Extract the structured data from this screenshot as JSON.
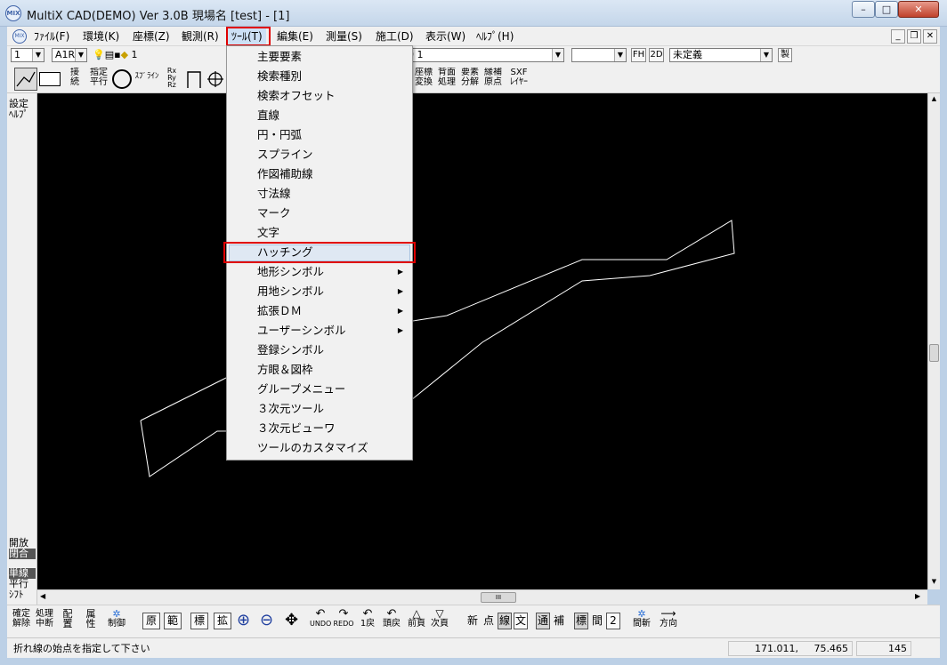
{
  "window": {
    "app_icon_text": "MIX",
    "title": "MultiX CAD(DEMO)   Ver 3.0B   現場名 [test]   - [1]",
    "minimize_glyph": "–",
    "maximize_glyph": "□",
    "close_glyph": "✕"
  },
  "menubar": {
    "items": [
      "ﾌｧｲﾙ(F)",
      "環境(K)",
      "座標(Z)",
      "観測(R)",
      "ﾂｰﾙ(T)",
      "編集(E)",
      "測量(S)",
      "施工(D)",
      "表示(W)",
      "ﾍﾙﾌﾟ(H)"
    ],
    "active_item": "ﾂｰﾙ(T)",
    "mdi_buttons": [
      "_",
      "❒",
      "✕"
    ]
  },
  "toolbar_row1": {
    "combo_scale": "1",
    "combo_layer": "A1R",
    "layer_value": "1",
    "combo_line_style": "0 1",
    "combo_blank": "",
    "fh_label": "FH",
    "mode_2d_label": "2D",
    "combo_undefined": "未定義",
    "make_label": "製"
  },
  "toolbar_row2": {
    "tools_left": [
      "接\n続",
      "指定\n平行",
      "ｽﾌﾟﾗｲﾝ",
      "Rx\nRy\nRz"
    ],
    "tools_right": [
      "座標\n変換",
      "背面\n処理",
      "要素\n分解",
      "縁補\n原点",
      "SXF\nﾚｲﾔｰ"
    ]
  },
  "left_panel": {
    "top": [
      "設定",
      "ﾍﾙﾌﾟ"
    ],
    "bottom": [
      "開放",
      "閉合",
      "単線",
      "平行",
      "ｼﾌﾄ"
    ]
  },
  "tools_menu": {
    "items": [
      {
        "label": "主要要素",
        "submenu": false
      },
      {
        "label": "検索種別",
        "submenu": false
      },
      {
        "label": "検索オフセット",
        "submenu": false
      },
      {
        "label": "直線",
        "submenu": false
      },
      {
        "label": "円・円弧",
        "submenu": false
      },
      {
        "label": "スプライン",
        "submenu": false
      },
      {
        "label": "作図補助線",
        "submenu": false
      },
      {
        "label": "寸法線",
        "submenu": false
      },
      {
        "label": "マーク",
        "submenu": false
      },
      {
        "label": "文字",
        "submenu": false
      },
      {
        "label": "ハッチング",
        "submenu": false
      },
      {
        "label": "地形シンボル",
        "submenu": true
      },
      {
        "label": "用地シンボル",
        "submenu": true
      },
      {
        "label": "拡張ＤＭ",
        "submenu": true
      },
      {
        "label": "ユーザーシンボル",
        "submenu": true
      },
      {
        "label": "登録シンボル",
        "submenu": false
      },
      {
        "label": "方眼＆図枠",
        "submenu": false
      },
      {
        "label": "グループメニュー",
        "submenu": false
      },
      {
        "label": "３次元ツール",
        "submenu": false
      },
      {
        "label": "３次元ビューワ",
        "submenu": false
      },
      {
        "label": "ツールのカスタマイズ",
        "submenu": false
      }
    ],
    "highlighted": "ハッチング",
    "submenu_arrow": "▶"
  },
  "bottom_toolbar": {
    "left_tools": [
      "確定\n解除",
      "処理\n中断",
      "配\n置",
      "属\n性",
      "制御"
    ],
    "boxes1": [
      "原",
      "範",
      "標",
      "拡"
    ],
    "nav_tools": [
      "UNDO",
      "REDO",
      "1戻",
      "頭戻",
      "前頁",
      "次頁"
    ],
    "mode_labels": [
      "新",
      "点",
      "線",
      "文"
    ],
    "mode_labels2": [
      "通",
      "補"
    ],
    "mode_labels3": [
      "標",
      "間",
      "2"
    ],
    "right_tools": [
      "間斬",
      "方向"
    ]
  },
  "statusbar": {
    "message": "折れ線の始点を指定して下さい",
    "coord_x": "171.011,",
    "coord_y": "75.465",
    "count": "145"
  },
  "hscroll_thumb_glyph": "III",
  "colors": {
    "canvas_bg": "#000000",
    "drawing_line": "#ffffff",
    "highlight_border": "#e00000"
  }
}
